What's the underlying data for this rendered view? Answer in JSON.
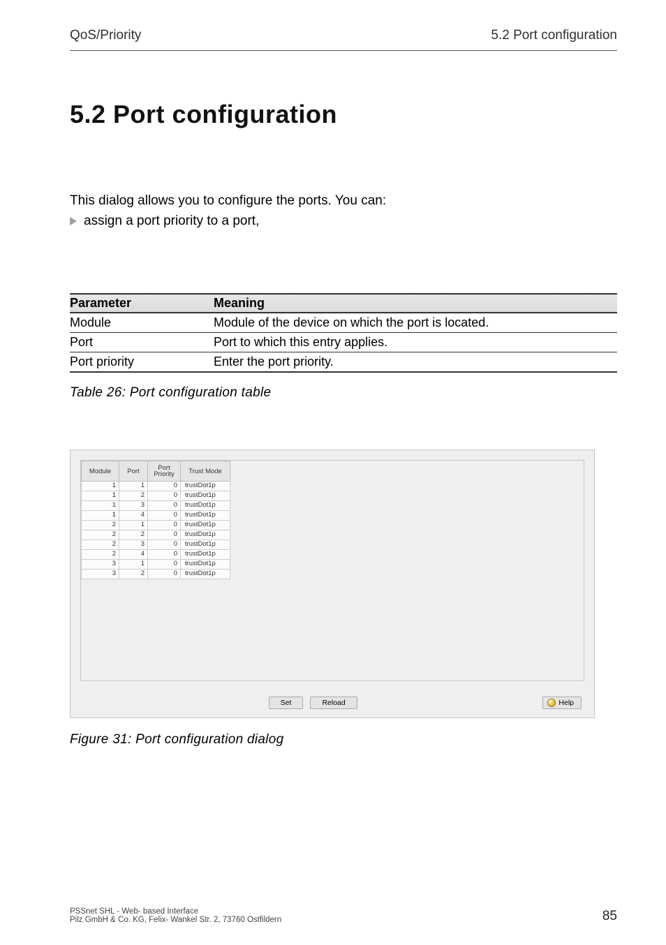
{
  "header": {
    "left": "QoS/Priority",
    "right": "5.2  Port configuration"
  },
  "title": "5.2   Port configuration",
  "intro_line": "This dialog allows you to configure the ports. You can:",
  "bullet_text": "assign a port priority to a port,",
  "param_table": {
    "head_parameter": "Parameter",
    "head_meaning": "Meaning",
    "rows": [
      {
        "param": "Module",
        "meaning": "Module of the device on which the port is located."
      },
      {
        "param": "Port",
        "meaning": "Port to which this entry applies."
      },
      {
        "param": "Port priority",
        "meaning": "Enter the port priority."
      }
    ]
  },
  "table_caption": "Table 26: Port configuration table",
  "dialog": {
    "headers": {
      "module": "Module",
      "port": "Port",
      "priority": "Port\nPriority",
      "trust": "Trust Mode"
    },
    "rows": [
      {
        "module": "1",
        "port": "1",
        "priority": "0",
        "trust": "trustDot1p"
      },
      {
        "module": "1",
        "port": "2",
        "priority": "0",
        "trust": "trustDot1p"
      },
      {
        "module": "1",
        "port": "3",
        "priority": "0",
        "trust": "trustDot1p"
      },
      {
        "module": "1",
        "port": "4",
        "priority": "0",
        "trust": "trustDot1p"
      },
      {
        "module": "2",
        "port": "1",
        "priority": "0",
        "trust": "trustDot1p"
      },
      {
        "module": "2",
        "port": "2",
        "priority": "0",
        "trust": "trustDot1p"
      },
      {
        "module": "2",
        "port": "3",
        "priority": "0",
        "trust": "trustDot1p"
      },
      {
        "module": "2",
        "port": "4",
        "priority": "0",
        "trust": "trustDot1p"
      },
      {
        "module": "3",
        "port": "1",
        "priority": "0",
        "trust": "trustDot1p"
      },
      {
        "module": "3",
        "port": "2",
        "priority": "0",
        "trust": "trustDot1p"
      }
    ],
    "buttons": {
      "set": "Set",
      "reload": "Reload",
      "help": "Help"
    }
  },
  "figure_caption": "Figure 31: Port configuration dialog",
  "footer": {
    "line1": "PSSnet SHL - Web- based Interface",
    "line2": "Pilz GmbH & Co. KG, Felix- Wankel Str. 2, 73760 Ostfildern",
    "page": "85"
  }
}
